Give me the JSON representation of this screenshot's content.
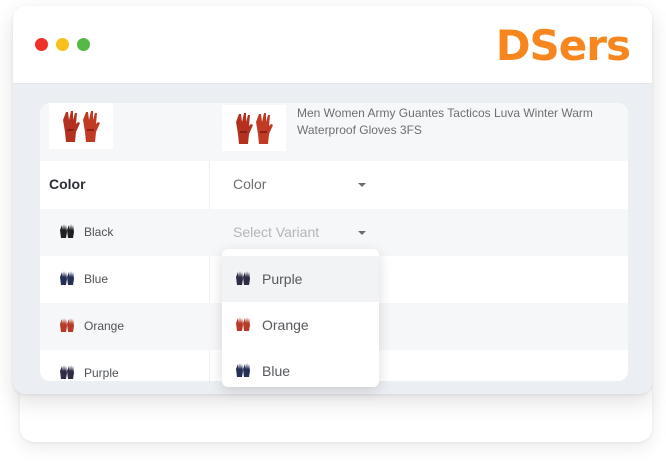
{
  "window": {
    "brand": "DSers"
  },
  "product": {
    "title": "Men Women Army Guantes Tacticos Luva Winter Warm Waterproof Gloves 3FS"
  },
  "mapping": {
    "attribute_label": "Color",
    "attribute_select_value": "Color",
    "variant_select_placeholder": "Select Variant",
    "variants": [
      {
        "label": "Black",
        "color": "#1f1f24"
      },
      {
        "label": "Blue",
        "color": "#263056"
      },
      {
        "label": "Orange",
        "color": "#b63b2a"
      },
      {
        "label": "Purple",
        "color": "#2f2c48"
      }
    ]
  },
  "dropdown": {
    "options": [
      {
        "label": "Purple",
        "color": "#2f2c48"
      },
      {
        "label": "Orange",
        "color": "#b63b2a"
      },
      {
        "label": "Blue",
        "color": "#263056"
      }
    ]
  },
  "colors": {
    "brand": "#f7861e",
    "dot_red": "#f0312a",
    "dot_yellow": "#f6c11b",
    "dot_green": "#58b847"
  },
  "icons": {
    "caret": "chevron-down-icon",
    "glove": "glove-icon"
  }
}
